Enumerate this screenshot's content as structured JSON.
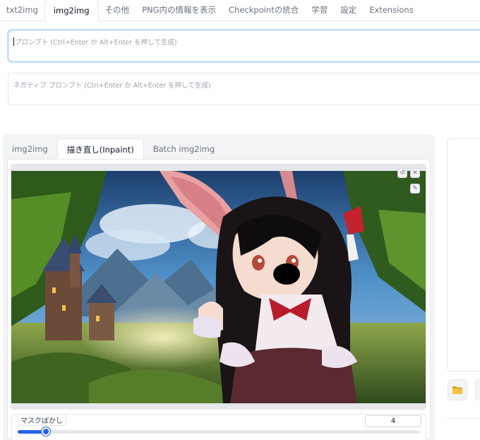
{
  "top_tabs": [
    {
      "label": "txt2img",
      "active": false
    },
    {
      "label": "img2img",
      "active": true
    },
    {
      "label": "その他",
      "active": false
    },
    {
      "label": "PNG内の情報を表示",
      "active": false
    },
    {
      "label": "Checkpointの統合",
      "active": false
    },
    {
      "label": "学習",
      "active": false
    },
    {
      "label": "設定",
      "active": false
    },
    {
      "label": "Extensions",
      "active": false
    }
  ],
  "prompt": {
    "placeholder": "プロンプト (Ctrl+Enter か Alt+Enter を押して生成)"
  },
  "negative_prompt": {
    "placeholder": "ネガティブ プロンプト (Ctrl+Enter か Alt+Enter を押して生成)"
  },
  "sub_tabs": [
    {
      "label": "img2img",
      "active": false
    },
    {
      "label": "描き直し(Inpaint)",
      "active": true
    },
    {
      "label": "Batch img2img",
      "active": false
    }
  ],
  "canvas": {
    "tools": [
      "undo-icon",
      "close-icon",
      "brush-icon"
    ]
  },
  "mask_blur": {
    "label": "マスクぼかし",
    "value": "4",
    "fraction": 0.07
  },
  "colors": {
    "accent": "#2563eb",
    "focus_border": "#93c5fd"
  },
  "right": {
    "icons": [
      "folder-icon"
    ]
  }
}
